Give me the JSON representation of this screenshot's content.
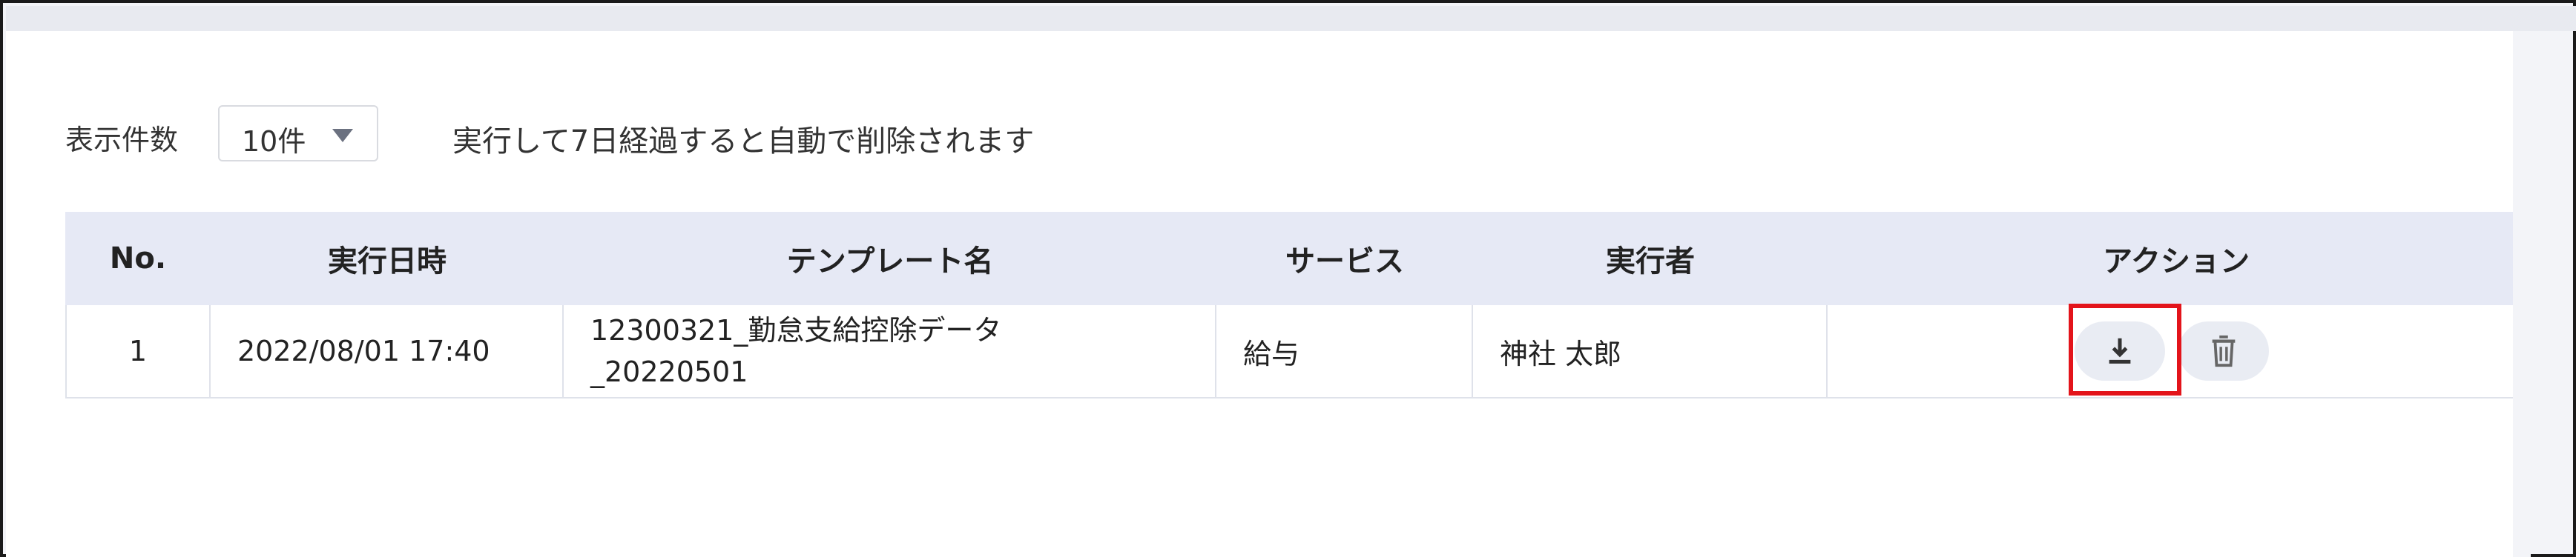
{
  "controls": {
    "display_count_label": "表示件数",
    "display_count_value": "10件",
    "retention_notice": "実行して7日経過すると自動で削除されます"
  },
  "table": {
    "headers": {
      "no": "No.",
      "executed_at": "実行日時",
      "template_name": "テンプレート名",
      "service": "サービス",
      "executor": "実行者",
      "action": "アクション"
    },
    "rows": [
      {
        "no": "1",
        "executed_at": "2022/08/01 17:40",
        "template_name": "12300321_勤怠支給控除データ\n_20220501",
        "service": "給与",
        "executor": "神社 太郎"
      }
    ]
  },
  "icons": {
    "caret": "chevron-down-icon",
    "download": "download-icon",
    "delete": "trash-icon"
  },
  "colors": {
    "header_bg": "#e6e9f5",
    "highlight": "#e3141b",
    "button_bg": "#e9ecf3"
  }
}
